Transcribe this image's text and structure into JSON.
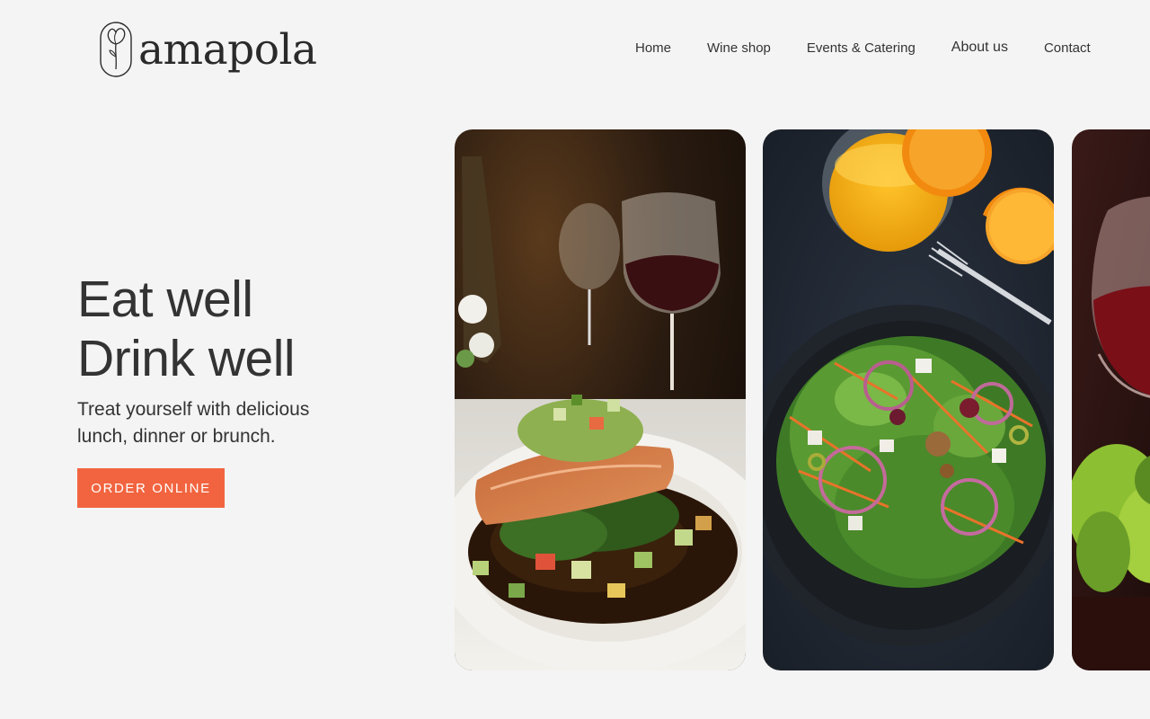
{
  "brand": {
    "name": "amapola",
    "logo_icon": "poppy-flower-icon"
  },
  "nav": {
    "home": "Home",
    "wine_shop": "Wine shop",
    "events": "Events & Catering",
    "about": "About us",
    "contact": "Contact"
  },
  "hero": {
    "headline_line1": "Eat well",
    "headline_line2": "Drink well",
    "subtext": "Treat yourself with delicious lunch, dinner or brunch.",
    "cta_label": "ORDER ONLINE"
  },
  "gallery": [
    {
      "subject": "salmon-dish-with-wine-glasses"
    },
    {
      "subject": "salad-plate-with-orange-juice"
    },
    {
      "subject": "red-wine-glass"
    }
  ],
  "colors": {
    "background": "#f4f4f4",
    "accent": "#f1643f",
    "text": "#333333"
  }
}
